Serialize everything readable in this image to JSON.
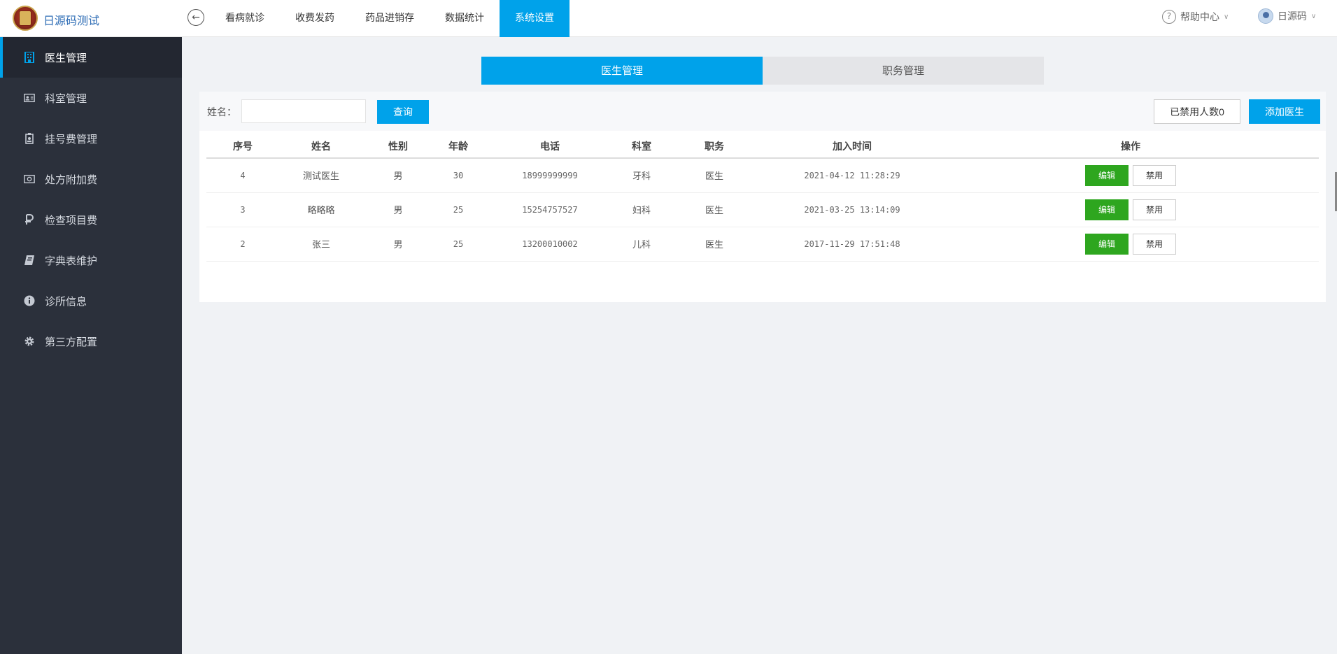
{
  "header": {
    "app_title": "日源码测试",
    "nav": [
      {
        "label": "看病就诊",
        "active": false
      },
      {
        "label": "收费发药",
        "active": false
      },
      {
        "label": "药品进销存",
        "active": false
      },
      {
        "label": "数据统计",
        "active": false
      },
      {
        "label": "系统设置",
        "active": true
      }
    ],
    "help_label": "帮助中心",
    "user_name": "日源码"
  },
  "sidebar": {
    "items": [
      {
        "label": "医生管理",
        "icon": "building-icon",
        "active": true
      },
      {
        "label": "科室管理",
        "icon": "id-card-icon",
        "active": false
      },
      {
        "label": "挂号费管理",
        "icon": "badge-icon",
        "active": false
      },
      {
        "label": "处方附加费",
        "icon": "money-icon",
        "active": false
      },
      {
        "label": "检查项目费",
        "icon": "currency-icon",
        "active": false
      },
      {
        "label": "字典表维护",
        "icon": "book-icon",
        "active": false
      },
      {
        "label": "诊所信息",
        "icon": "info-icon",
        "active": false
      },
      {
        "label": "第三方配置",
        "icon": "gear-icon",
        "active": false
      }
    ]
  },
  "tabs": {
    "doctor": "医生管理",
    "position": "职务管理"
  },
  "search": {
    "label": "姓名：",
    "value": "",
    "query_button": "查询",
    "disabled_count_button": "已禁用人数0",
    "add_button": "添加医生"
  },
  "table": {
    "columns": [
      "序号",
      "姓名",
      "性别",
      "年龄",
      "电话",
      "科室",
      "职务",
      "加入时间",
      "操作"
    ],
    "rows": [
      {
        "no": "4",
        "name": "测试医生",
        "gender": "男",
        "age": "30",
        "phone": "18999999999",
        "dept": "牙科",
        "role": "医生",
        "joined": "2021-04-12 11:28:29"
      },
      {
        "no": "3",
        "name": "略略略",
        "gender": "男",
        "age": "25",
        "phone": "15254757527",
        "dept": "妇科",
        "role": "医生",
        "joined": "2021-03-25 13:14:09"
      },
      {
        "no": "2",
        "name": "张三",
        "gender": "男",
        "age": "25",
        "phone": "13200010002",
        "dept": "儿科",
        "role": "医生",
        "joined": "2017-11-29 17:51:48"
      }
    ],
    "edit_label": "编辑",
    "ban_label": "禁用"
  },
  "colors": {
    "accent": "#00a2ea",
    "sidebar_bg": "#2b303b",
    "edit_green": "#2ea61f"
  }
}
